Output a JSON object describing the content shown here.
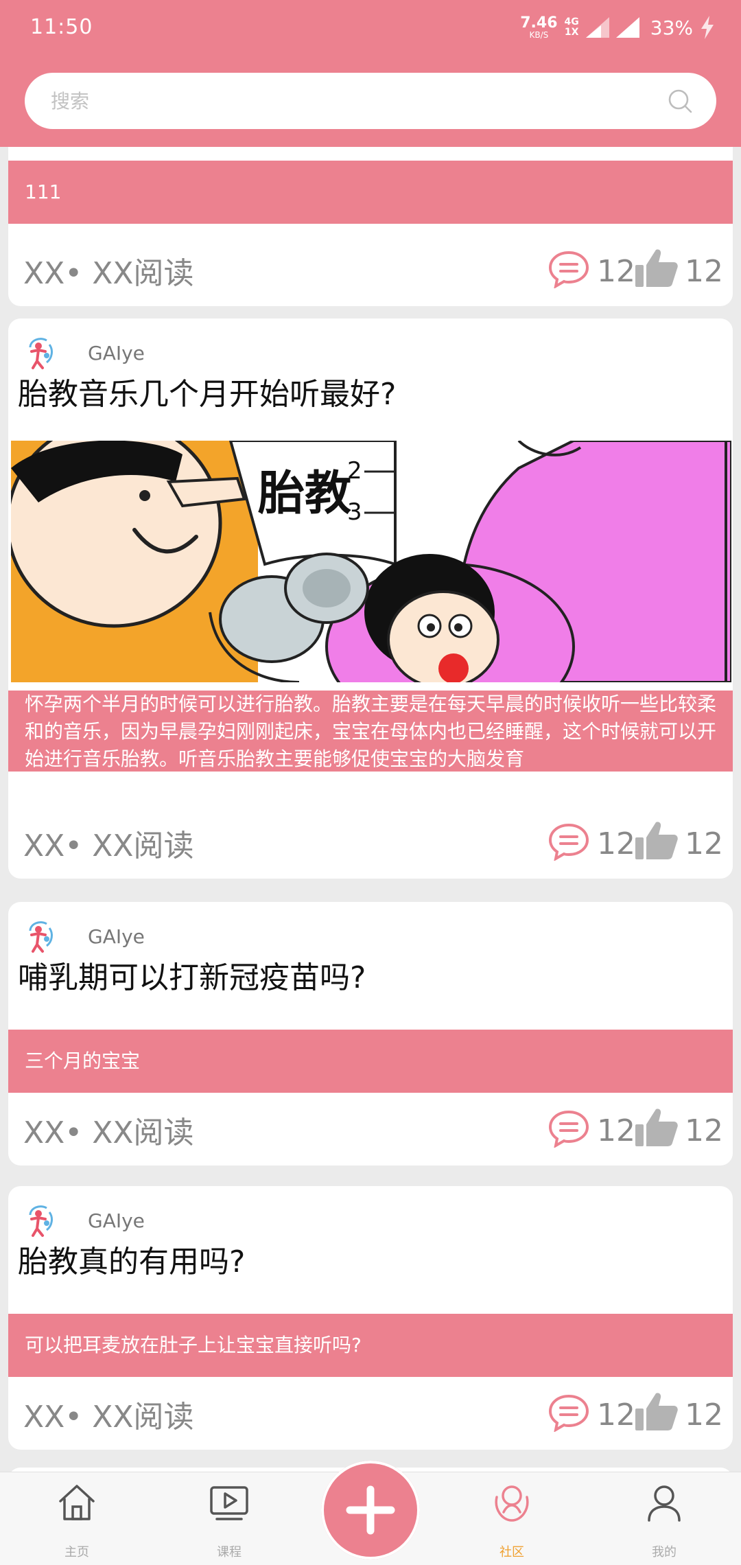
{
  "status_bar": {
    "time": "11:50",
    "net_speed": "7.46",
    "net_speed_unit": "KB/S",
    "net_type_top": "4G",
    "net_type_bottom": "1X",
    "battery": "33%"
  },
  "search": {
    "placeholder": "搜索"
  },
  "feed": {
    "posts": [
      {
        "excerpt": "111",
        "read": "XX• XX阅读",
        "comments": "12",
        "likes": "12"
      },
      {
        "author": "GAIye",
        "title": "胎教音乐几个月开始听最好?",
        "image_icon": "prenatal-education-illustration",
        "image_text": "胎教",
        "image_numbers": [
          "2",
          "3"
        ],
        "excerpt": "怀孕两个半月的时候可以进行胎教。胎教主要是在每天早晨的时候收听一些比较柔和的音乐，因为早晨孕妇刚刚起床，宝宝在母体内也已经睡醒，这个时候就可以开始进行音乐胎教。听音乐胎教主要能够促使宝宝的大脑发育",
        "read": "XX• XX阅读",
        "comments": "12",
        "likes": "12"
      },
      {
        "author": "GAIye",
        "title": "哺乳期可以打新冠疫苗吗?",
        "excerpt": "三个月的宝宝",
        "read": "XX• XX阅读",
        "comments": "12",
        "likes": "12"
      },
      {
        "author": "GAIye",
        "title": "胎教真的有用吗?",
        "excerpt": "可以把耳麦放在肚子上让宝宝直接听吗?",
        "read": "XX• XX阅读",
        "comments": "12",
        "likes": "12"
      }
    ]
  },
  "tab_bar": {
    "tabs": [
      {
        "label": "主页",
        "icon": "home-icon"
      },
      {
        "label": "课程",
        "icon": "play-icon"
      },
      {
        "label": "社区",
        "icon": "community-icon",
        "active": true
      },
      {
        "label": "我的",
        "icon": "profile-icon"
      }
    ],
    "fab_icon": "plus-icon"
  },
  "colors": {
    "accent": "#ec818f",
    "active_tab": "#f0a030",
    "icon_gray": "#b3b3b3",
    "background": "#ebebeb"
  }
}
